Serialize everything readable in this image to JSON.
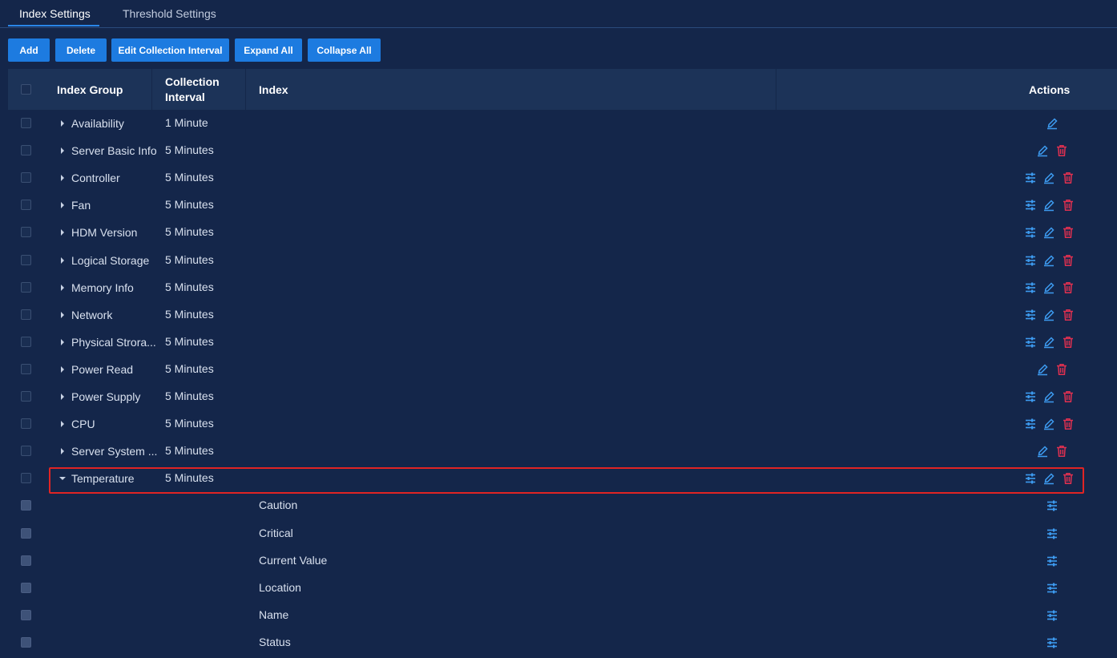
{
  "tabs": [
    {
      "label": "Index Settings",
      "active": true
    },
    {
      "label": "Threshold Settings",
      "active": false
    }
  ],
  "toolbar": {
    "add": "Add",
    "delete": "Delete",
    "edit_interval": "Edit Collection Interval",
    "expand_all": "Expand All",
    "collapse_all": "Collapse All"
  },
  "table": {
    "columns": {
      "group": "Index Group",
      "interval_line1": "Collection",
      "interval_line2": "Interval",
      "index": "Index",
      "actions": "Actions"
    },
    "rows": [
      {
        "group": "Availability",
        "interval": "1 Minute",
        "actions": [
          "edit"
        ]
      },
      {
        "group": "Server Basic Info",
        "interval": "5 Minutes",
        "actions": [
          "edit",
          "delete"
        ]
      },
      {
        "group": "Controller",
        "interval": "5 Minutes",
        "actions": [
          "settings",
          "edit",
          "delete"
        ]
      },
      {
        "group": "Fan",
        "interval": "5 Minutes",
        "actions": [
          "settings",
          "edit",
          "delete"
        ]
      },
      {
        "group": "HDM Version",
        "interval": "5 Minutes",
        "actions": [
          "settings",
          "edit",
          "delete"
        ]
      },
      {
        "group": "Logical Storage",
        "interval": "5 Minutes",
        "actions": [
          "settings",
          "edit",
          "delete"
        ]
      },
      {
        "group": "Memory Info",
        "interval": "5 Minutes",
        "actions": [
          "settings",
          "edit",
          "delete"
        ]
      },
      {
        "group": "Network",
        "interval": "5 Minutes",
        "actions": [
          "settings",
          "edit",
          "delete"
        ]
      },
      {
        "group": "Physical Strora...",
        "interval": "5 Minutes",
        "actions": [
          "settings",
          "edit",
          "delete"
        ]
      },
      {
        "group": "Power Read",
        "interval": "5 Minutes",
        "actions": [
          "edit",
          "delete"
        ]
      },
      {
        "group": "Power Supply",
        "interval": "5 Minutes",
        "actions": [
          "settings",
          "edit",
          "delete"
        ]
      },
      {
        "group": "CPU",
        "interval": "5 Minutes",
        "actions": [
          "settings",
          "edit",
          "delete"
        ]
      },
      {
        "group": "Server System ...",
        "interval": "5 Minutes",
        "actions": [
          "edit",
          "delete"
        ]
      },
      {
        "group": "Temperature",
        "interval": "5 Minutes",
        "expanded": true,
        "actions": [
          "settings",
          "edit",
          "delete"
        ]
      }
    ],
    "children": [
      {
        "index": "Caution"
      },
      {
        "index": "Critical"
      },
      {
        "index": "Current Value"
      },
      {
        "index": "Location"
      },
      {
        "index": "Name"
      },
      {
        "index": "Status"
      }
    ]
  },
  "colors": {
    "accent": "#1d7be0",
    "icon_blue": "#3d9bf0",
    "icon_red": "#e03050",
    "highlight": "#e02424"
  }
}
